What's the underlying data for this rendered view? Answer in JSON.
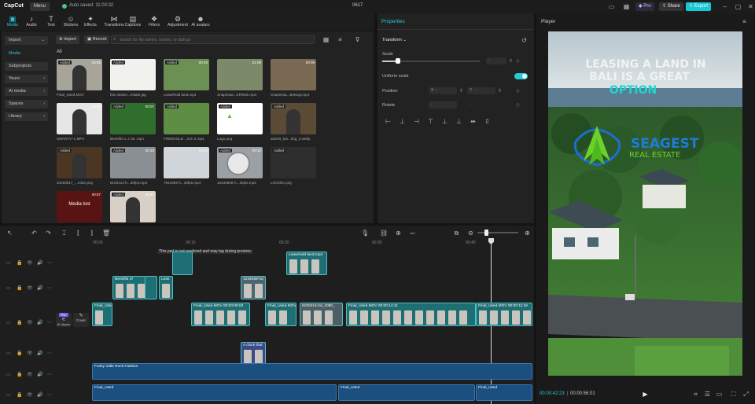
{
  "app": {
    "logo": "CapCut",
    "menu": "Menu",
    "autosave": "Auto saved: 11:00:32",
    "project_title": "0617",
    "pro": "Pro",
    "share": "Share",
    "export": "Export"
  },
  "toolbar": [
    {
      "label": "Media",
      "icon": "media-icon"
    },
    {
      "label": "Audio",
      "icon": "audio-icon"
    },
    {
      "label": "Text",
      "icon": "text-icon"
    },
    {
      "label": "Stickers",
      "icon": "stickers-icon"
    },
    {
      "label": "Effects",
      "icon": "effects-icon"
    },
    {
      "label": "Transitions",
      "icon": "transitions-icon"
    },
    {
      "label": "Captions",
      "icon": "captions-icon"
    },
    {
      "label": "Filters",
      "icon": "filters-icon"
    },
    {
      "label": "Adjustment",
      "icon": "adjustment-icon"
    },
    {
      "label": "AI avatars",
      "icon": "ai-avatars-icon"
    }
  ],
  "media_sidebar": {
    "import": "Import",
    "media": "Media",
    "subprojects": "Subprojects",
    "yours": "Yours",
    "ai_media": "AI media",
    "spaces": "Spaces",
    "library": "Library"
  },
  "media_toolbar": {
    "import": "Import",
    "record": "Record",
    "search_placeholder": "Search for file names, scenes, or dialogs",
    "filter_all": "All"
  },
  "media_items": [
    {
      "name": "Final_Used.MOV",
      "dur": "03:55",
      "added": "Added"
    },
    {
      "name": "foto Seaze...estate.jpg",
      "dur": "",
      "added": "Added"
    },
    {
      "name": "Leasehold land.mp4",
      "dur": "00:49",
      "added": "Added"
    },
    {
      "name": "SnapInsta...ERWdc.mp4",
      "dur": "01:09",
      "added": ""
    },
    {
      "name": "SnapInsta...BWUgt.mp4",
      "dur": "00:09",
      "added": ""
    },
    {
      "name": "SMARTV~1.MP4",
      "dur": "00:09",
      "added": ""
    },
    {
      "name": "Benefits o..t via .mp4",
      "dur": "00:07",
      "added": "Added"
    },
    {
      "name": "FREEHOLD ...lem 2.mp4",
      "dur": "",
      "added": "Added"
    },
    {
      "name": "Logo.png",
      "dur": "",
      "added": "Added"
    },
    {
      "name": "assets_tas...ting_3.webp",
      "dur": "",
      "added": "Added"
    },
    {
      "name": "20250617_...e42e.png",
      "dur": "",
      "added": "Added"
    },
    {
      "name": "6100414-h...30fps.mp4",
      "dur": "00:10",
      "added": "Added"
    },
    {
      "name": "7841699-h...30fps.mp4",
      "dur": "00:10",
      "added": ""
    },
    {
      "name": "10340608-h...25fps.mp4",
      "dur": "00:10",
      "added": "Added"
    },
    {
      "name": "LOGOkc.png",
      "dur": "",
      "added": "Added"
    },
    {
      "name": "Media lost",
      "dur": "00:57",
      "added": ""
    },
    {
      "name": "",
      "dur": "00:57",
      "added": "Added"
    }
  ],
  "properties": {
    "title": "Properties",
    "transform": "Transform",
    "scale": "Scale",
    "uniform_scale": "Uniform scale",
    "position": "Position",
    "pos_x": "X",
    "pos_y": "Y",
    "rotate": "Rotate",
    "dash": "-",
    "scale_progress": 0.16
  },
  "player": {
    "title": "Player",
    "headline1": "LEASING A LAND IN",
    "headline2": "BALI IS A GREAT",
    "headline3": "OPTION",
    "brand1": "SEAGEST",
    "brand2": "REAL ESTATE",
    "current_time": "00:00:42:23",
    "total_time": "00:00:56:01"
  },
  "timeline": {
    "ruler": [
      "00:00",
      "00:10",
      "00:20",
      "00:30",
      "00:40"
    ],
    "warning": "This part is not rendered and may lag during preview.",
    "clips": [
      {
        "label": "Leasehold land.mp4"
      },
      {
        "label": "Benefits of"
      },
      {
        "label": "Leas"
      },
      {
        "label": "1034068-hd"
      },
      {
        "label": "Final_Used"
      },
      {
        "label": "Final_Used.MOV 00:00:06:03"
      },
      {
        "label": "Final_Used.MOV"
      },
      {
        "label": "6100414-hd_1080_"
      },
      {
        "label": "Final_Used.MOV 00:00:14:11"
      },
      {
        "label": "Final_Used.MOV 00:00:11:18"
      },
      {
        "label": "A clock that"
      },
      {
        "label": "Funky Indie Rock Fashion"
      },
      {
        "label": "Final_Used"
      },
      {
        "label": "Final_Used"
      },
      {
        "label": "Final_Used"
      }
    ],
    "pro_badge": "Pro",
    "ai_tool": "AI clipper",
    "cover": "Cover"
  }
}
